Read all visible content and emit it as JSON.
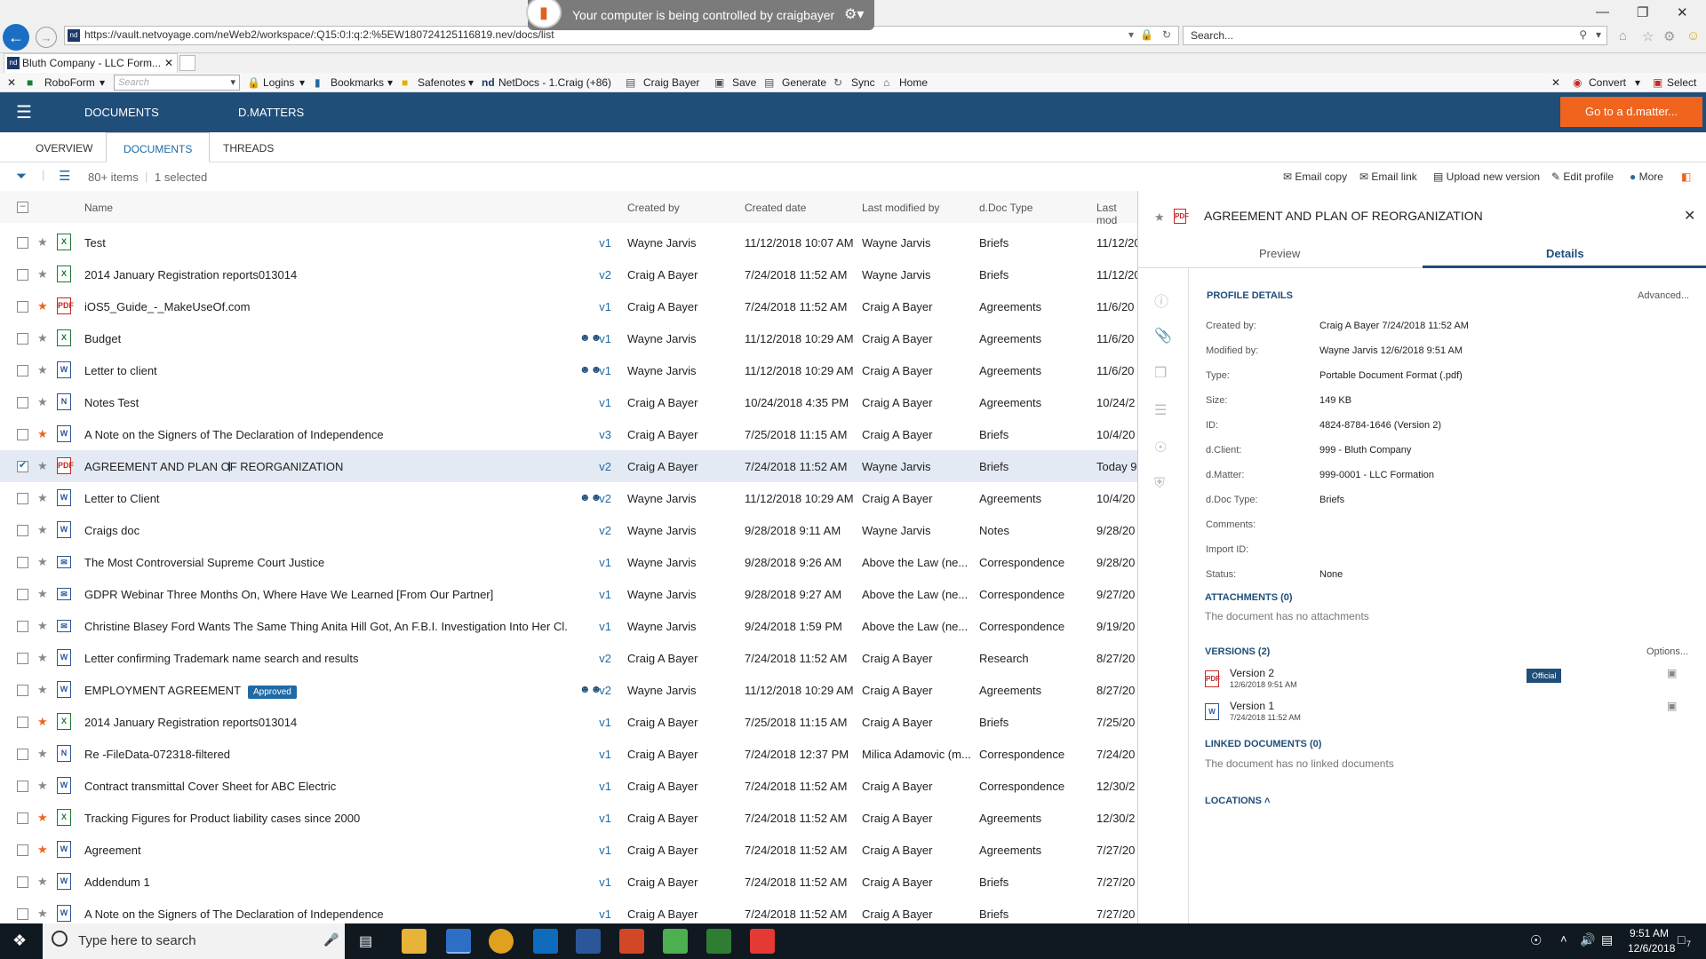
{
  "browser": {
    "url": "https://vault.netvoyage.com/neWeb2/workspace/:Q15:0:l:q:2:%5EW180724125116819.nev/docs/list",
    "search_placeholder": "Search...",
    "control_banner": "Your computer is being controlled by craigbayer",
    "tab_title": "Bluth Company - LLC Form..."
  },
  "bookmarks": {
    "roboform": "RoboForm",
    "search_placeholder": "Search",
    "logins": "Logins",
    "bookmarks": "Bookmarks",
    "safenotes": "Safenotes",
    "netdocs": "NetDocs - 1.Craig (+86)",
    "craig": "Craig Bayer",
    "save": "Save",
    "generate": "Generate",
    "sync": "Sync",
    "home": "Home",
    "convert": "Convert",
    "select": "Select"
  },
  "header": {
    "documents": "DOCUMENTS",
    "dmatters": "D.MATTERS",
    "go_matter": "Go to a d.matter..."
  },
  "subtabs": {
    "overview": "OVERVIEW",
    "documents": "DOCUMENTS",
    "threads": "THREADS"
  },
  "toolbar": {
    "count": "80+ items",
    "selected": "1 selected",
    "email_copy": "Email copy",
    "email_link": "Email link",
    "upload": "Upload new version",
    "edit": "Edit profile",
    "more": "More"
  },
  "columns": {
    "name": "Name",
    "created_by": "Created by",
    "created_date": "Created date",
    "last_modified_by": "Last modified by",
    "doc_type": "d.Doc Type",
    "last_mod": "Last mod"
  },
  "rows": [
    {
      "icon": "excel",
      "fav": false,
      "name": "Test",
      "badge": "",
      "shared": false,
      "ver": "v1",
      "cby": "Wayne Jarvis",
      "cdate": "11/12/2018 10:07 AM",
      "mby": "Wayne Jarvis",
      "type": "Briefs",
      "lmod": "11/12/20"
    },
    {
      "icon": "excel",
      "fav": false,
      "name": "2014 January Registration reports013014",
      "badge": "",
      "shared": false,
      "ver": "v2",
      "cby": "Craig A Bayer",
      "cdate": "7/24/2018 11:52 AM",
      "mby": "Wayne Jarvis",
      "type": "Briefs",
      "lmod": "11/12/20"
    },
    {
      "icon": "pdf",
      "fav": true,
      "name": "iOS5_Guide_-_MakeUseOf.com",
      "badge": "",
      "shared": false,
      "ver": "v1",
      "cby": "Craig A Bayer",
      "cdate": "7/24/2018 11:52 AM",
      "mby": "Craig A Bayer",
      "type": "Agreements",
      "lmod": "11/6/20"
    },
    {
      "icon": "excel",
      "fav": false,
      "name": "Budget",
      "badge": "",
      "shared": true,
      "ver": "v1",
      "cby": "Wayne Jarvis",
      "cdate": "11/12/2018 10:29 AM",
      "mby": "Craig A Bayer",
      "type": "Agreements",
      "lmod": "11/6/20"
    },
    {
      "icon": "word",
      "fav": false,
      "name": "Letter to client",
      "badge": "",
      "shared": true,
      "ver": "v1",
      "cby": "Wayne Jarvis",
      "cdate": "11/12/2018 10:29 AM",
      "mby": "Craig A Bayer",
      "type": "Agreements",
      "lmod": "11/6/20"
    },
    {
      "icon": "note",
      "fav": false,
      "name": "Notes Test",
      "badge": "",
      "shared": false,
      "ver": "v1",
      "cby": "Craig A Bayer",
      "cdate": "10/24/2018 4:35 PM",
      "mby": "Craig A Bayer",
      "type": "Agreements",
      "lmod": "10/24/2"
    },
    {
      "icon": "word",
      "fav": true,
      "name": "A Note on the Signers of The Declaration of Independence",
      "badge": "",
      "shared": false,
      "ver": "v3",
      "cby": "Craig A Bayer",
      "cdate": "7/25/2018 11:15 AM",
      "mby": "Craig A Bayer",
      "type": "Briefs",
      "lmod": "10/4/20"
    },
    {
      "icon": "pdf",
      "fav": false,
      "sel": true,
      "name": "AGREEMENT AND PLAN OF REORGANIZATION",
      "badge": "",
      "shared": false,
      "ver": "v2",
      "cby": "Craig A Bayer",
      "cdate": "7/24/2018 11:52 AM",
      "mby": "Wayne Jarvis",
      "type": "Briefs",
      "lmod": "Today 9"
    },
    {
      "icon": "word",
      "fav": false,
      "name": "Letter to Client",
      "badge": "",
      "shared": true,
      "ver": "v2",
      "cby": "Wayne Jarvis",
      "cdate": "11/12/2018 10:29 AM",
      "mby": "Craig A Bayer",
      "type": "Agreements",
      "lmod": "10/4/20"
    },
    {
      "icon": "word",
      "fav": false,
      "name": "Craigs doc",
      "badge": "",
      "shared": false,
      "ver": "v2",
      "cby": "Wayne Jarvis",
      "cdate": "9/28/2018 9:11 AM",
      "mby": "Wayne Jarvis",
      "type": "Notes",
      "lmod": "9/28/20"
    },
    {
      "icon": "mail",
      "fav": false,
      "name": "The Most Controversial Supreme Court Justice",
      "badge": "",
      "shared": false,
      "ver": "v1",
      "cby": "Wayne Jarvis",
      "cdate": "9/28/2018 9:26 AM",
      "mby": "Above the Law (ne...",
      "type": "Correspondence",
      "lmod": "9/28/20"
    },
    {
      "icon": "mail",
      "fav": false,
      "name": "GDPR Webinar Three Months On, Where Have We Learned [From Our Partner]",
      "badge": "",
      "shared": false,
      "ver": "v1",
      "cby": "Wayne Jarvis",
      "cdate": "9/28/2018 9:27 AM",
      "mby": "Above the Law (ne...",
      "type": "Correspondence",
      "lmod": "9/27/20"
    },
    {
      "icon": "mail",
      "fav": false,
      "name": "Christine Blasey Ford Wants The Same Thing Anita Hill Got, An F.B.I. Investigation Into Her Cl...",
      "badge": "",
      "shared": false,
      "ver": "v1",
      "cby": "Wayne Jarvis",
      "cdate": "9/24/2018 1:59 PM",
      "mby": "Above the Law (ne...",
      "type": "Correspondence",
      "lmod": "9/19/20"
    },
    {
      "icon": "word",
      "fav": false,
      "name": "Letter confirming Trademark name search and results",
      "badge": "",
      "shared": false,
      "ver": "v2",
      "cby": "Craig A Bayer",
      "cdate": "7/24/2018 11:52 AM",
      "mby": "Craig A Bayer",
      "type": "Research",
      "lmod": "8/27/20"
    },
    {
      "icon": "word",
      "fav": false,
      "name": "EMPLOYMENT AGREEMENT",
      "badge": "Approved",
      "shared": true,
      "ver": "v2",
      "cby": "Wayne Jarvis",
      "cdate": "11/12/2018 10:29 AM",
      "mby": "Craig A Bayer",
      "type": "Agreements",
      "lmod": "8/27/20"
    },
    {
      "icon": "excel",
      "fav": true,
      "name": "2014 January Registration reports013014",
      "badge": "",
      "shared": false,
      "ver": "v1",
      "cby": "Craig A Bayer",
      "cdate": "7/25/2018 11:15 AM",
      "mby": "Craig A Bayer",
      "type": "Briefs",
      "lmod": "7/25/20"
    },
    {
      "icon": "note",
      "fav": false,
      "name": "Re -FileData-072318-filtered",
      "badge": "",
      "shared": false,
      "ver": "v1",
      "cby": "Craig A Bayer",
      "cdate": "7/24/2018 12:37 PM",
      "mby": "Milica Adamovic (m...",
      "type": "Correspondence",
      "lmod": "7/24/20"
    },
    {
      "icon": "word",
      "fav": false,
      "name": "Contract transmittal Cover Sheet for ABC Electric",
      "badge": "",
      "shared": false,
      "ver": "v1",
      "cby": "Craig A Bayer",
      "cdate": "7/24/2018 11:52 AM",
      "mby": "Craig A Bayer",
      "type": "Correspondence",
      "lmod": "12/30/2"
    },
    {
      "icon": "excel",
      "fav": true,
      "name": "Tracking Figures for Product liability cases since 2000",
      "badge": "",
      "shared": false,
      "ver": "v1",
      "cby": "Craig A Bayer",
      "cdate": "7/24/2018 11:52 AM",
      "mby": "Craig A Bayer",
      "type": "Agreements",
      "lmod": "12/30/2"
    },
    {
      "icon": "word",
      "fav": true,
      "name": "Agreement",
      "badge": "",
      "shared": false,
      "ver": "v1",
      "cby": "Craig A Bayer",
      "cdate": "7/24/2018 11:52 AM",
      "mby": "Craig A Bayer",
      "type": "Agreements",
      "lmod": "7/27/20"
    },
    {
      "icon": "word",
      "fav": false,
      "name": "Addendum 1",
      "badge": "",
      "shared": false,
      "ver": "v1",
      "cby": "Craig A Bayer",
      "cdate": "7/24/2018 11:52 AM",
      "mby": "Craig A Bayer",
      "type": "Briefs",
      "lmod": "7/27/20"
    },
    {
      "icon": "word",
      "fav": false,
      "name": "A Note on the Signers of The Declaration of Independence",
      "badge": "",
      "shared": false,
      "ver": "v1",
      "cby": "Craig A Bayer",
      "cdate": "7/24/2018 11:52 AM",
      "mby": "Craig A Bayer",
      "type": "Briefs",
      "lmod": "7/27/20"
    }
  ],
  "panel": {
    "title": "AGREEMENT AND PLAN OF REORGANIZATION",
    "tab_preview": "Preview",
    "tab_details": "Details",
    "profile_details": "PROFILE DETAILS",
    "advanced": "Advanced...",
    "fields": [
      {
        "label": "Created by:",
        "value": "Craig A Bayer 7/24/2018 11:52 AM"
      },
      {
        "label": "Modified by:",
        "value": "Wayne Jarvis 12/6/2018 9:51 AM"
      },
      {
        "label": "Type:",
        "value": "Portable Document Format (.pdf)"
      },
      {
        "label": "Size:",
        "value": "149 KB"
      },
      {
        "label": "ID:",
        "value": "4824-8784-1646 (Version 2)"
      },
      {
        "label": "d.Client:",
        "value": "999 - Bluth Company"
      },
      {
        "label": "d.Matter:",
        "value": "999-0001 - LLC Formation"
      },
      {
        "label": "d.Doc Type:",
        "value": "Briefs"
      },
      {
        "label": "Comments:",
        "value": ""
      },
      {
        "label": "Import ID:",
        "value": ""
      },
      {
        "label": "Status:",
        "value": "None"
      }
    ],
    "attachments_title": "ATTACHMENTS (0)",
    "attachments_empty": "The document has no attachments",
    "versions_title": "VERSIONS (2)",
    "options": "Options...",
    "versions": [
      {
        "name": "Version 2",
        "date": "12/6/2018 9:51 AM",
        "badge": "Official"
      },
      {
        "name": "Version 1",
        "date": "7/24/2018 11:52 AM",
        "badge": ""
      }
    ],
    "linked_title": "LINKED DOCUMENTS (0)",
    "linked_empty": "The document has no linked documents",
    "locations": "LOCATIONS"
  },
  "taskbar": {
    "search_placeholder": "Type here to search",
    "time": "9:51 AM",
    "date": "12/6/2018",
    "notif_count": "7"
  },
  "colors": {
    "header_bg": "#1f4e79",
    "accent": "#f0641e",
    "link": "#1f6aa5"
  }
}
